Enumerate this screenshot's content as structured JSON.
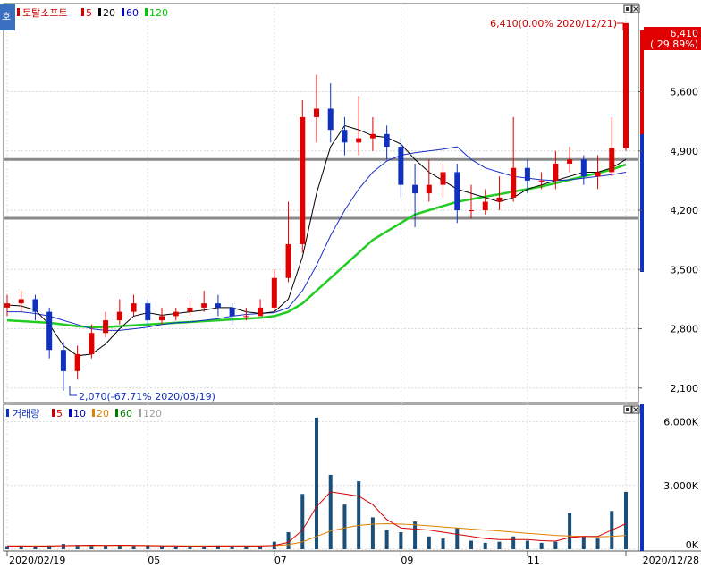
{
  "price_panel": {
    "side_tab": "호",
    "title": "토탈소프트",
    "ma_legend": [
      {
        "label": "5",
        "color": "#d40000"
      },
      {
        "label": "20",
        "color": "#000000"
      },
      {
        "label": "60",
        "color": "#0000c8"
      },
      {
        "label": "120",
        "color": "#00c800"
      }
    ],
    "y_ticks": [
      "5,600",
      "4,900",
      "4,200",
      "3,500",
      "2,800",
      "2,100"
    ],
    "y_values": [
      5600,
      4900,
      4200,
      3500,
      2800,
      2100
    ],
    "ylim": [
      1950,
      6620
    ],
    "current_price": "6,410",
    "current_change": "( 29.89%)",
    "high_note": "6,410(0.00% 2020/12/21)",
    "low_note": "2,070(-67.71% 2020/03/19)",
    "hlines": [
      4800,
      4105
    ]
  },
  "volume_panel": {
    "title": "거래량",
    "ma_legend": [
      {
        "label": "5",
        "color": "#d40000"
      },
      {
        "label": "10",
        "color": "#0000c8"
      },
      {
        "label": "20",
        "color": "#e08000"
      },
      {
        "label": "60",
        "color": "#008000"
      },
      {
        "label": "120",
        "color": "#a0a0a0"
      }
    ],
    "y_ticks": [
      "6,000K",
      "3,000K",
      "0K"
    ],
    "y_values": [
      6000,
      3000,
      0
    ],
    "ylim": [
      0,
      6700
    ]
  },
  "x_axis": {
    "labels": [
      "2020/02/19",
      "05",
      "07",
      "09",
      "11",
      "2020/12/28"
    ]
  },
  "chart_data": {
    "type": "candlestick",
    "x": [
      "02/19",
      "02/26",
      "03/04",
      "03/11",
      "03/18",
      "03/25",
      "04/01",
      "04/08",
      "04/15",
      "04/22",
      "04/29",
      "05/06",
      "05/13",
      "05/20",
      "05/27",
      "06/03",
      "06/10",
      "06/17",
      "06/24",
      "07/01",
      "07/08",
      "07/15",
      "07/22",
      "07/29",
      "08/05",
      "08/12",
      "08/19",
      "08/26",
      "09/02",
      "09/09",
      "09/16",
      "09/23",
      "09/30",
      "10/07",
      "10/14",
      "10/21",
      "10/28",
      "11/04",
      "11/11",
      "11/18",
      "11/25",
      "12/02",
      "12/09",
      "12/16",
      "12/21"
    ],
    "open": [
      3050,
      3100,
      3150,
      3000,
      2550,
      2300,
      2500,
      2750,
      2900,
      3000,
      3100,
      2900,
      2950,
      3000,
      3050,
      3100,
      3050,
      2950,
      2950,
      3050,
      3400,
      3800,
      5300,
      5400,
      5150,
      5000,
      5050,
      5100,
      4950,
      4500,
      4400,
      4500,
      4650,
      4200,
      4200,
      4300,
      4350,
      4700,
      4550,
      4550,
      4750,
      4800,
      4600,
      4650,
      4935
    ],
    "close": [
      3100,
      3150,
      3000,
      2550,
      2300,
      2500,
      2750,
      2900,
      3000,
      3100,
      2900,
      2950,
      3000,
      3050,
      3100,
      3050,
      2950,
      2950,
      3050,
      3400,
      3800,
      5300,
      5400,
      5150,
      5000,
      5050,
      5100,
      4950,
      4500,
      4400,
      4500,
      4650,
      4200,
      4200,
      4300,
      4350,
      4700,
      4550,
      4550,
      4750,
      4800,
      4600,
      4650,
      4935,
      6410
    ],
    "high": [
      3200,
      3250,
      3200,
      3050,
      2650,
      2600,
      2850,
      3000,
      3150,
      3200,
      3150,
      3050,
      3050,
      3150,
      3250,
      3200,
      3100,
      3050,
      3150,
      3500,
      4300,
      5500,
      5800,
      5700,
      5300,
      5550,
      5300,
      5200,
      5050,
      4750,
      4800,
      4750,
      4750,
      4500,
      4450,
      4600,
      5300,
      4800,
      4650,
      4900,
      4950,
      4850,
      4850,
      5300,
      6410
    ],
    "low": [
      2950,
      3000,
      2900,
      2450,
      2070,
      2200,
      2450,
      2700,
      2850,
      2950,
      2850,
      2850,
      2900,
      2950,
      3000,
      2950,
      2850,
      2900,
      2950,
      3000,
      3350,
      3700,
      5000,
      5000,
      4850,
      4850,
      4900,
      4800,
      4350,
      4000,
      4300,
      4350,
      4050,
      4100,
      4150,
      4200,
      4300,
      4400,
      4450,
      4450,
      4650,
      4500,
      4450,
      4600,
      4900
    ],
    "ma20": [
      3080,
      3070,
      3020,
      2850,
      2600,
      2480,
      2500,
      2620,
      2800,
      2950,
      2990,
      2960,
      2980,
      3000,
      3020,
      3050,
      3050,
      3000,
      2980,
      3000,
      3150,
      3650,
      4400,
      4950,
      5200,
      5150,
      5080,
      5060,
      4980,
      4800,
      4650,
      4550,
      4450,
      4400,
      4350,
      4300,
      4350,
      4450,
      4500,
      4550,
      4600,
      4650,
      4650,
      4700,
      4800
    ],
    "ma60": [
      3000,
      3000,
      2980,
      2950,
      2900,
      2850,
      2800,
      2780,
      2780,
      2800,
      2820,
      2850,
      2870,
      2880,
      2900,
      2920,
      2950,
      2970,
      2980,
      2990,
      3050,
      3250,
      3550,
      3900,
      4200,
      4450,
      4650,
      4780,
      4850,
      4880,
      4900,
      4920,
      4950,
      4800,
      4700,
      4650,
      4600,
      4580,
      4560,
      4550,
      4560,
      4580,
      4600,
      4620,
      4650
    ],
    "ma120": [
      2900,
      2890,
      2880,
      2870,
      2850,
      2830,
      2820,
      2820,
      2830,
      2840,
      2850,
      2860,
      2870,
      2880,
      2890,
      2900,
      2910,
      2920,
      2930,
      2950,
      3000,
      3100,
      3250,
      3400,
      3550,
      3700,
      3850,
      3950,
      4050,
      4150,
      4200,
      4250,
      4300,
      4330,
      4360,
      4390,
      4420,
      4450,
      4480,
      4520,
      4560,
      4600,
      4640,
      4680,
      4740
    ],
    "volume": [
      150,
      130,
      120,
      180,
      250,
      200,
      150,
      180,
      200,
      160,
      180,
      140,
      120,
      130,
      150,
      180,
      120,
      140,
      160,
      350,
      800,
      2600,
      6200,
      3500,
      2100,
      3200,
      1500,
      900,
      800,
      1300,
      600,
      500,
      1000,
      400,
      300,
      350,
      600,
      400,
      300,
      350,
      1700,
      600,
      500,
      1800,
      2700
    ],
    "vol_ma5": [
      150,
      150,
      140,
      150,
      170,
      180,
      190,
      180,
      190,
      180,
      170,
      160,
      150,
      140,
      140,
      150,
      150,
      150,
      150,
      180,
      320,
      900,
      2000,
      2700,
      2600,
      2500,
      2100,
      1400,
      1000,
      950,
      900,
      800,
      700,
      600,
      500,
      450,
      450,
      450,
      400,
      380,
      550,
      600,
      600,
      900,
      1200
    ],
    "vol_ma20": [
      160,
      160,
      160,
      160,
      165,
      170,
      170,
      175,
      175,
      180,
      180,
      170,
      165,
      160,
      160,
      160,
      155,
      155,
      160,
      170,
      210,
      340,
      600,
      860,
      1000,
      1120,
      1180,
      1200,
      1180,
      1150,
      1100,
      1050,
      1000,
      950,
      900,
      860,
      800,
      750,
      700,
      650,
      620,
      600,
      580,
      600,
      650
    ]
  }
}
